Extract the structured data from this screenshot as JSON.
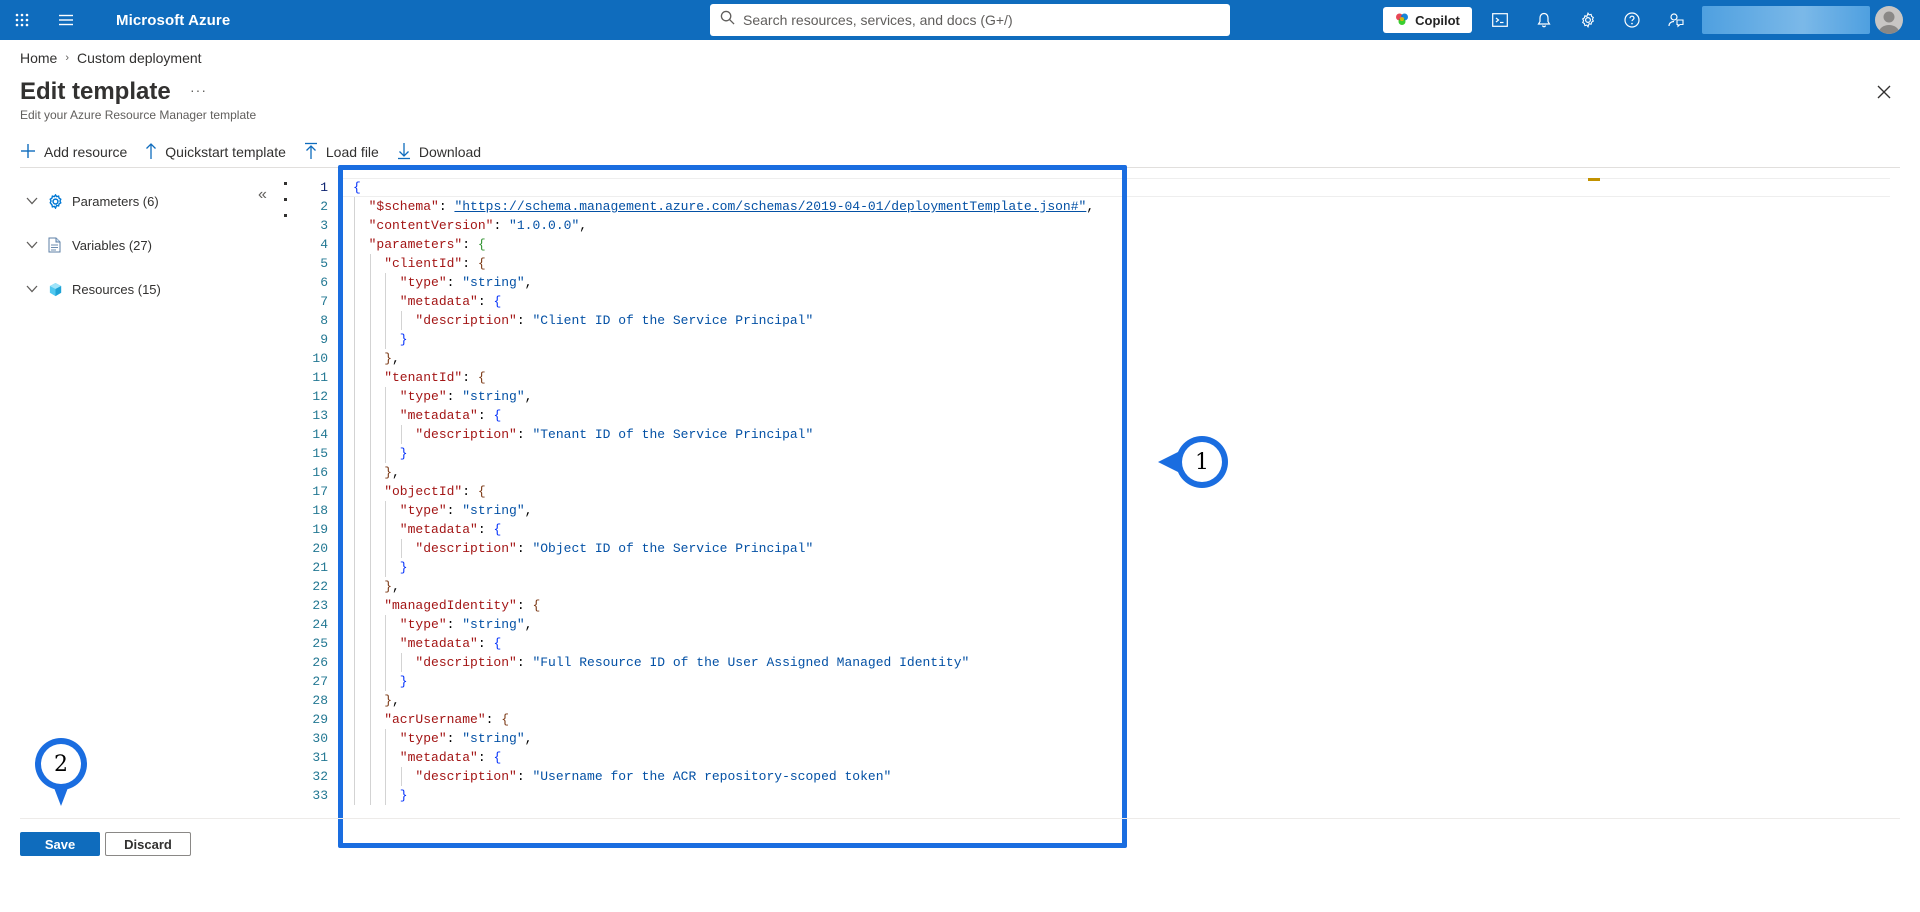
{
  "topbar": {
    "brand": "Microsoft Azure",
    "search_placeholder": "Search resources, services, and docs (G+/)",
    "copilot_label": "Copilot",
    "accent": "#0f6cbd"
  },
  "breadcrumb": [
    "Home",
    "Custom deployment"
  ],
  "page": {
    "title": "Edit template",
    "more": "···",
    "subtitle": "Edit your Azure Resource Manager template"
  },
  "toolbar": {
    "add_resource": "Add resource",
    "quickstart": "Quickstart template",
    "load_file": "Load file",
    "download": "Download"
  },
  "tree": [
    {
      "label": "Parameters (6)",
      "icon": "gear-icon"
    },
    {
      "label": "Variables (27)",
      "icon": "document-icon"
    },
    {
      "label": "Resources (15)",
      "icon": "cube-icon"
    }
  ],
  "editor": {
    "line_numbers": [
      "1",
      "2",
      "3",
      "4",
      "5",
      "6",
      "7",
      "8",
      "9",
      "10",
      "11",
      "12",
      "13",
      "14",
      "15",
      "16",
      "17",
      "18",
      "19",
      "20",
      "21",
      "22",
      "23",
      "24",
      "25",
      "26",
      "27",
      "28",
      "29",
      "30",
      "31",
      "32",
      "33"
    ],
    "active_line": "1",
    "lines": [
      [
        [
          "b1",
          "{"
        ]
      ],
      [
        [
          "k",
          "  \"$schema\""
        ],
        [
          "p",
          ": "
        ],
        [
          "url",
          "\"https://schema.management.azure.com/schemas/2019-04-01/deploymentTemplate.json#\""
        ],
        [
          "p",
          ","
        ]
      ],
      [
        [
          "k",
          "  \"contentVersion\""
        ],
        [
          "p",
          ": "
        ],
        [
          "s",
          "\"1.0.0.0\""
        ],
        [
          "p",
          ","
        ]
      ],
      [
        [
          "k",
          "  \"parameters\""
        ],
        [
          "p",
          ": "
        ],
        [
          "b2",
          "{"
        ]
      ],
      [
        [
          "k",
          "    \"clientId\""
        ],
        [
          "p",
          ": "
        ],
        [
          "b3",
          "{"
        ]
      ],
      [
        [
          "k",
          "      \"type\""
        ],
        [
          "p",
          ": "
        ],
        [
          "s",
          "\"string\""
        ],
        [
          "p",
          ","
        ]
      ],
      [
        [
          "k",
          "      \"metadata\""
        ],
        [
          "p",
          ": "
        ],
        [
          "b1",
          "{"
        ]
      ],
      [
        [
          "k",
          "        \"description\""
        ],
        [
          "p",
          ": "
        ],
        [
          "s",
          "\"Client ID of the Service Principal\""
        ]
      ],
      [
        [
          "b1",
          "      }"
        ]
      ],
      [
        [
          "b3",
          "    }"
        ],
        [
          "p",
          ","
        ]
      ],
      [
        [
          "k",
          "    \"tenantId\""
        ],
        [
          "p",
          ": "
        ],
        [
          "b3",
          "{"
        ]
      ],
      [
        [
          "k",
          "      \"type\""
        ],
        [
          "p",
          ": "
        ],
        [
          "s",
          "\"string\""
        ],
        [
          "p",
          ","
        ]
      ],
      [
        [
          "k",
          "      \"metadata\""
        ],
        [
          "p",
          ": "
        ],
        [
          "b1",
          "{"
        ]
      ],
      [
        [
          "k",
          "        \"description\""
        ],
        [
          "p",
          ": "
        ],
        [
          "s",
          "\"Tenant ID of the Service Principal\""
        ]
      ],
      [
        [
          "b1",
          "      }"
        ]
      ],
      [
        [
          "b3",
          "    }"
        ],
        [
          "p",
          ","
        ]
      ],
      [
        [
          "k",
          "    \"objectId\""
        ],
        [
          "p",
          ": "
        ],
        [
          "b3",
          "{"
        ]
      ],
      [
        [
          "k",
          "      \"type\""
        ],
        [
          "p",
          ": "
        ],
        [
          "s",
          "\"string\""
        ],
        [
          "p",
          ","
        ]
      ],
      [
        [
          "k",
          "      \"metadata\""
        ],
        [
          "p",
          ": "
        ],
        [
          "b1",
          "{"
        ]
      ],
      [
        [
          "k",
          "        \"description\""
        ],
        [
          "p",
          ": "
        ],
        [
          "s",
          "\"Object ID of the Service Principal\""
        ]
      ],
      [
        [
          "b1",
          "      }"
        ]
      ],
      [
        [
          "b3",
          "    }"
        ],
        [
          "p",
          ","
        ]
      ],
      [
        [
          "k",
          "    \"managedIdentity\""
        ],
        [
          "p",
          ": "
        ],
        [
          "b3",
          "{"
        ]
      ],
      [
        [
          "k",
          "      \"type\""
        ],
        [
          "p",
          ": "
        ],
        [
          "s",
          "\"string\""
        ],
        [
          "p",
          ","
        ]
      ],
      [
        [
          "k",
          "      \"metadata\""
        ],
        [
          "p",
          ": "
        ],
        [
          "b1",
          "{"
        ]
      ],
      [
        [
          "k",
          "        \"description\""
        ],
        [
          "p",
          ": "
        ],
        [
          "s",
          "\"Full Resource ID of the User Assigned Managed Identity\""
        ]
      ],
      [
        [
          "b1",
          "      }"
        ]
      ],
      [
        [
          "b3",
          "    }"
        ],
        [
          "p",
          ","
        ]
      ],
      [
        [
          "k",
          "    \"acrUsername\""
        ],
        [
          "p",
          ": "
        ],
        [
          "b3",
          "{"
        ]
      ],
      [
        [
          "k",
          "      \"type\""
        ],
        [
          "p",
          ": "
        ],
        [
          "s",
          "\"string\""
        ],
        [
          "p",
          ","
        ]
      ],
      [
        [
          "k",
          "      \"metadata\""
        ],
        [
          "p",
          ": "
        ],
        [
          "b1",
          "{"
        ]
      ],
      [
        [
          "k",
          "        \"description\""
        ],
        [
          "p",
          ": "
        ],
        [
          "s",
          "\"Username for the ACR repository-scoped token\""
        ]
      ],
      [
        [
          "b1",
          "      }"
        ]
      ]
    ]
  },
  "annotations": {
    "badge1": "1",
    "badge2": "2",
    "color": "#1a6de0"
  },
  "footer": {
    "save": "Save",
    "discard": "Discard"
  }
}
